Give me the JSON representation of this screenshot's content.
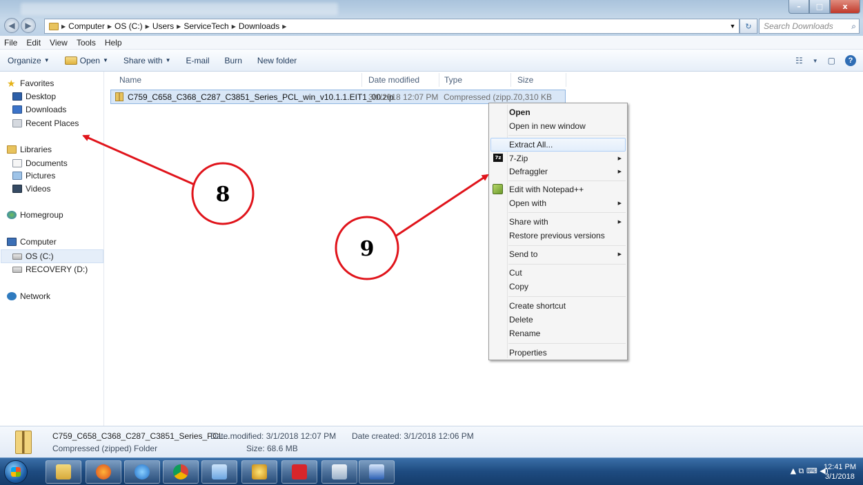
{
  "window": {
    "controls": {
      "minimize": "–",
      "maximize": "□",
      "close": "x"
    }
  },
  "navigation": {
    "back_glyph": "◀",
    "forward_glyph": "▶",
    "breadcrumb": [
      "Computer",
      "OS (C:)",
      "Users",
      "ServiceTech",
      "Downloads"
    ],
    "separator": "▶",
    "refresh_glyph": "↻",
    "search_placeholder": "Search Downloads",
    "search_icon": "search-icon"
  },
  "menubar": [
    "File",
    "Edit",
    "View",
    "Tools",
    "Help"
  ],
  "commandbar": {
    "organize": "Organize",
    "open": "Open",
    "share_with": "Share with",
    "email": "E-mail",
    "burn": "Burn",
    "new_folder": "New folder",
    "dropdown_arrow": "▼",
    "view_icon": "☷",
    "preview_icon": "▢",
    "help_icon": "?"
  },
  "sidebar": {
    "favorites": "Favorites",
    "desktop": "Desktop",
    "downloads": "Downloads",
    "recent_places": "Recent Places",
    "libraries": "Libraries",
    "documents": "Documents",
    "pictures": "Pictures",
    "videos": "Videos",
    "homegroup": "Homegroup",
    "computer": "Computer",
    "os_c": "OS (C:)",
    "recovery_d": "RECOVERY (D:)",
    "network": "Network",
    "star_glyph": "★"
  },
  "filelist": {
    "columns": {
      "name": "Name",
      "date_modified": "Date modified",
      "type": "Type",
      "size": "Size"
    },
    "rows": [
      {
        "name": "C759_C658_C368_C287_C3851_Series_PCL_win_v10.1.1.EIT1_00.zip",
        "date_modified": "3/1/2018 12:07 PM",
        "type": "Compressed (zipp...",
        "size": "70,310 KB"
      }
    ]
  },
  "context_menu": {
    "open": "Open",
    "open_new_window": "Open in new window",
    "extract_all": "Extract All...",
    "seven_zip": "7-Zip",
    "defraggler": "Defraggler",
    "edit_npp": "Edit with Notepad++",
    "open_with": "Open with",
    "share_with": "Share with",
    "restore": "Restore previous versions",
    "send_to": "Send to",
    "cut": "Cut",
    "copy": "Copy",
    "create_shortcut": "Create shortcut",
    "delete": "Delete",
    "rename": "Rename",
    "properties": "Properties",
    "submenu_arrow": "▶",
    "zip_icon_text": "7z"
  },
  "annotations": {
    "callout_8": "8",
    "callout_9": "9",
    "color": "#e0141b"
  },
  "details": {
    "name": "C759_C658_C368_C287_C3851_Series_PCL...",
    "type": "Compressed (zipped) Folder",
    "date_modified": "Date modified: 3/1/2018 12:07 PM",
    "size": "Size: 68.6 MB",
    "date_created": "Date created: 3/1/2018 12:06 PM"
  },
  "taskbar": {
    "apps": [
      "file-explorer-icon",
      "firefox-icon",
      "internet-explorer-icon",
      "chrome-icon",
      "control-panel-icon",
      "settings-gear-icon",
      "acrobat-icon",
      "office-icon",
      "word-icon"
    ],
    "tray_icons": "▲  ⧉  ⌨  ◀)",
    "time": "12:41 PM",
    "date": "3/1/2018"
  }
}
